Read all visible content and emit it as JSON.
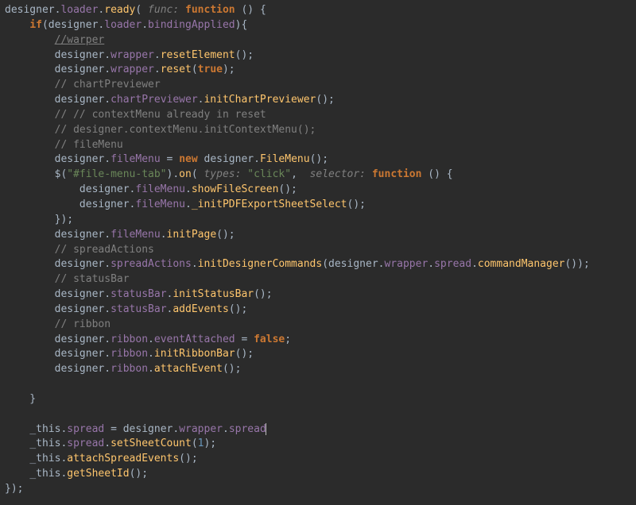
{
  "hints": {
    "func": "func:",
    "types": "types:",
    "selector": "selector:"
  },
  "kw": {
    "function": "function",
    "if": "if",
    "new": "new",
    "this": "this",
    "true": "true",
    "false": "false"
  },
  "id": {
    "designer": "designer",
    "loader": "loader",
    "ready": "ready",
    "bindingApplied": "bindingApplied",
    "wrapper": "wrapper",
    "resetElement": "resetElement",
    "reset": "reset",
    "chartPreviewer": "chartPreviewer",
    "initChartPreviewer": "initChartPreviewer",
    "fileMenu": "fileMenu",
    "FileMenu": "FileMenu",
    "on": "on",
    "showFileScreen": "showFileScreen",
    "initPDFExportSheetSelect": "_initPDFExportSheetSelect",
    "initPage": "initPage",
    "spreadActions": "spreadActions",
    "initDesignerCommands": "initDesignerCommands",
    "spread": "spread",
    "commandManager": "commandManager",
    "statusBar": "statusBar",
    "initStatusBar": "initStatusBar",
    "addEvents": "addEvents",
    "ribbon": "ribbon",
    "eventAttached": "eventAttached",
    "initRibbonBar": "initRibbonBar",
    "attachEvent": "attachEvent",
    "_this": "_this",
    "setSheetCount": "setSheetCount",
    "attachSpreadEvents": "attachSpreadEvents",
    "getSheetId": "getSheetId",
    "dollar": "$"
  },
  "str": {
    "fileMenuTab": "\"#file-menu-tab\"",
    "click": "\"click\""
  },
  "lit": {
    "one": "1"
  },
  "cmt": {
    "warper": "//warper",
    "chartPreviewer": "// chartPreviewer",
    "ctx1": "// // contextMenu already in reset",
    "ctx2": "// designer.contextMenu.initContextMenu();",
    "fileMenu": "// fileMenu",
    "spreadActions": "// spreadActions",
    "statusBar": "// statusBar",
    "ribbon": "// ribbon"
  }
}
